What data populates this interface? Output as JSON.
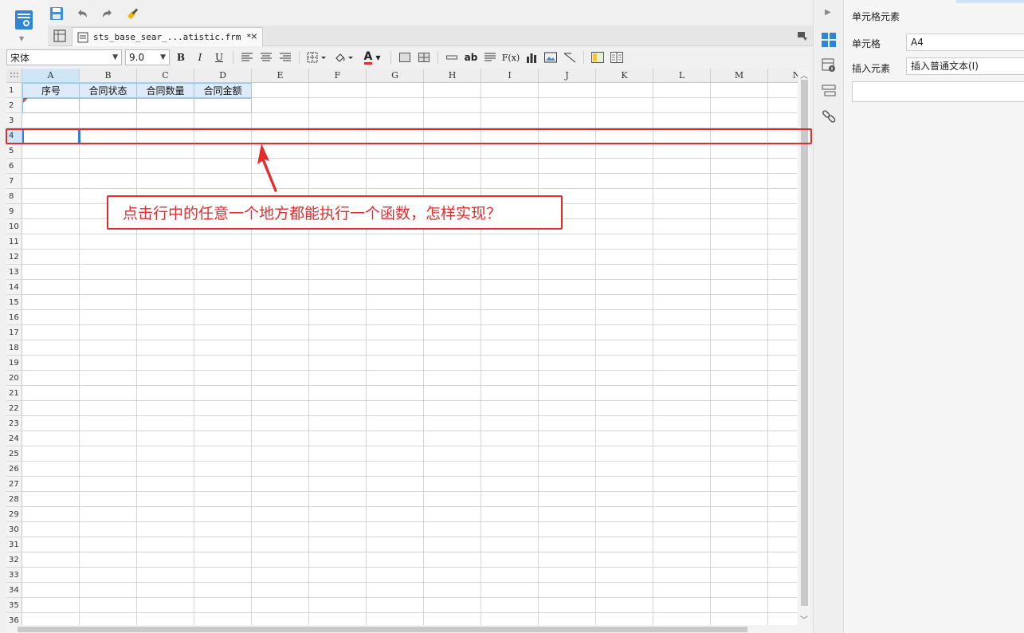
{
  "app": {
    "logo_icon": "report-designer-logo-icon"
  },
  "quick_toolbar": {
    "items": [
      {
        "name": "save-icon"
      },
      {
        "name": "undo-icon"
      },
      {
        "name": "redo-icon"
      },
      {
        "name": "format-painter-icon"
      }
    ]
  },
  "tabs": {
    "file_tab_label": "sts_base_sear_...atistic.frm *",
    "close_glyph": "×"
  },
  "format_toolbar": {
    "font_family": "宋体",
    "font_size": "9.0",
    "bold": "B",
    "italic": "I",
    "underline": "U",
    "text_color_glyph": "A",
    "text_color": "#e62b2b",
    "ab_label": "ab",
    "fx_label": "F(x)"
  },
  "sheet": {
    "columns": [
      "A",
      "B",
      "C",
      "D",
      "E",
      "F",
      "G",
      "H",
      "I",
      "J",
      "K",
      "L",
      "M",
      "N"
    ],
    "rows": [
      "1",
      "2",
      "3",
      "4",
      "5",
      "6",
      "7",
      "8",
      "9",
      "10",
      "11",
      "12",
      "13",
      "14",
      "15",
      "16",
      "17",
      "18",
      "19",
      "20",
      "21",
      "22",
      "23",
      "24",
      "25",
      "26",
      "27",
      "28",
      "29",
      "30",
      "31",
      "32",
      "33",
      "34",
      "35",
      "36"
    ],
    "header_cells": [
      "序号",
      "合同状态",
      "合同数量",
      "合同金额"
    ],
    "selected_cell": "A4",
    "selected_row": "4"
  },
  "annotation": {
    "callout_text": "点击行中的任意一个地方都能执行一个函数，怎样实现？",
    "color": "#e62b2b"
  },
  "properties": {
    "title": "单元格元素",
    "cell_label": "单元格",
    "cell_value": "A4",
    "insert_label": "插入元素",
    "insert_value": "插入普通文本(I)"
  }
}
